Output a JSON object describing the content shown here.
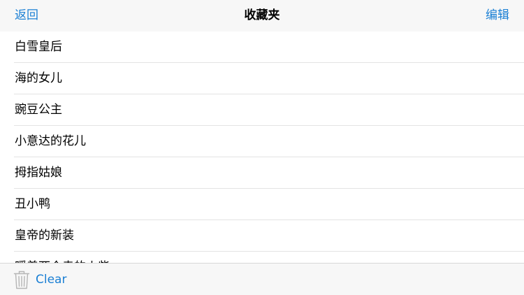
{
  "navbar": {
    "back_label": "返回",
    "title": "收藏夹",
    "edit_label": "编辑"
  },
  "favorites": {
    "items": [
      {
        "label": "白雪皇后"
      },
      {
        "label": "海的女儿"
      },
      {
        "label": "豌豆公主"
      },
      {
        "label": "小意达的花儿"
      },
      {
        "label": "拇指姑娘"
      },
      {
        "label": "丑小鸭"
      },
      {
        "label": "皇帝的新装"
      },
      {
        "label": "暖着两个卖的火柴"
      }
    ]
  },
  "toolbar": {
    "clear_label": "Clear",
    "clear_icon": "trash-icon"
  },
  "colors": {
    "accent": "#1a7fd4",
    "bar_background": "#f7f7f7",
    "separator": "#e3e3e3",
    "icon_gray": "#b5b5b5"
  }
}
